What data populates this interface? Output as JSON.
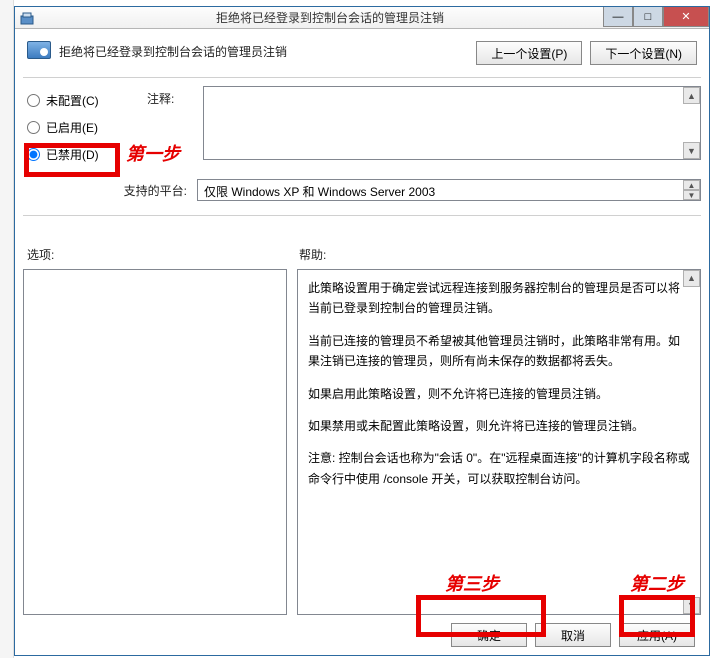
{
  "window": {
    "title": "拒绝将已经登录到控制台会话的管理员注销",
    "buttons": {
      "min": "—",
      "max": "□",
      "close": "✕"
    }
  },
  "header": {
    "policy_title": "拒绝将已经登录到控制台会话的管理员注销",
    "prev_button": "上一个设置(P)",
    "next_button": "下一个设置(N)"
  },
  "config": {
    "radios": {
      "not_configured": "未配置(C)",
      "enabled": "已启用(E)",
      "disabled": "已禁用(D)"
    },
    "note_label": "注释:",
    "platform_label": "支持的平台:",
    "platform_value": "仅限 Windows XP 和 Windows Server 2003"
  },
  "labels": {
    "options": "选项:",
    "help": "帮助:"
  },
  "help_paragraphs": [
    "此策略设置用于确定尝试远程连接到服务器控制台的管理员是否可以将当前已登录到控制台的管理员注销。",
    "当前已连接的管理员不希望被其他管理员注销时，此策略非常有用。如果注销已连接的管理员，则所有尚未保存的数据都将丢失。",
    "如果启用此策略设置，则不允许将已连接的管理员注销。",
    "如果禁用或未配置此策略设置，则允许将已连接的管理员注销。",
    "注意: 控制台会话也称为\"会话 0\"。在\"远程桌面连接\"的计算机字段名称或命令行中使用 /console 开关，可以获取控制台访问。"
  ],
  "footer": {
    "ok": "确定",
    "cancel": "取消",
    "apply": "应用(A)"
  },
  "annotations": {
    "step1": "第一步",
    "step2": "第二步",
    "step3": "第三步"
  },
  "scroll_icons": {
    "up": "▲",
    "down": "▼"
  }
}
